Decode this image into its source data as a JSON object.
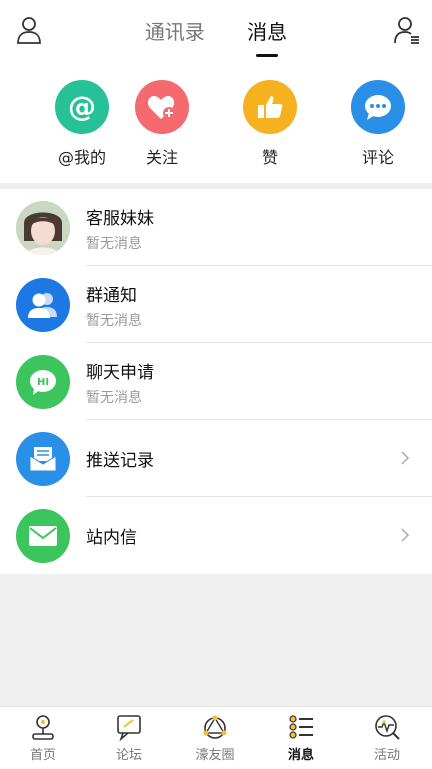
{
  "header": {
    "tabs": [
      {
        "label": "通讯录"
      },
      {
        "label": "消息"
      }
    ]
  },
  "quick_actions": [
    {
      "label": "@我的",
      "icon": "at-icon",
      "color": "#26c196"
    },
    {
      "label": "关注",
      "icon": "heart-plus-icon",
      "color": "#f46a6f"
    },
    {
      "label": "赞",
      "icon": "thumbs-up-icon",
      "color": "#f6b21e"
    },
    {
      "label": "评论",
      "icon": "chat-bubble-icon",
      "color": "#2a8fe6"
    }
  ],
  "messages": [
    {
      "title": "客服妹妹",
      "subtitle": "暂无消息",
      "icon": "avatar-photo"
    },
    {
      "title": "群通知",
      "subtitle": "暂无消息",
      "icon": "group-icon",
      "color": "#1e78e4"
    },
    {
      "title": "聊天申请",
      "subtitle": "暂无消息",
      "icon": "hi-bubble-icon",
      "color": "#3cc55c"
    },
    {
      "title": "推送记录",
      "icon": "push-mail-icon",
      "color": "#2a8fe6"
    },
    {
      "title": "站内信",
      "icon": "envelope-icon",
      "color": "#3cc55c"
    }
  ],
  "bottom_nav": [
    {
      "label": "首页",
      "icon": "joystick-icon"
    },
    {
      "label": "论坛",
      "icon": "forum-icon"
    },
    {
      "label": "濠友圈",
      "icon": "circle-network-icon"
    },
    {
      "label": "消息",
      "icon": "message-list-icon",
      "active": true
    },
    {
      "label": "活动",
      "icon": "activity-search-icon"
    }
  ]
}
